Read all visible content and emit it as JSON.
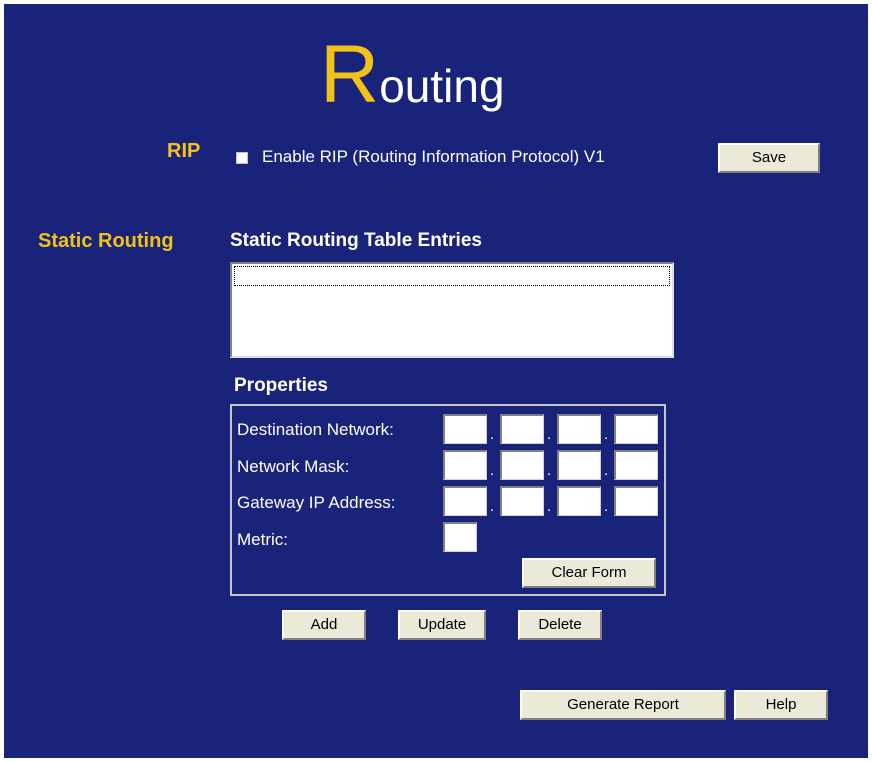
{
  "page": {
    "background": "#1a237a",
    "title_initial": "R",
    "title_rest": "outing",
    "accent_color": "#f2c21b"
  },
  "rip": {
    "section_label": "RIP",
    "checkbox_label": "Enable RIP (Routing Information Protocol) V1",
    "enabled": false,
    "save_label": "Save"
  },
  "static_routing": {
    "section_label": "Static Routing",
    "table_heading": "Static Routing Table Entries",
    "entries": []
  },
  "properties": {
    "heading": "Properties",
    "destination_label": "Destination Network:",
    "mask_label": "Network Mask:",
    "gateway_label": "Gateway IP Address:",
    "metric_label": "Metric:",
    "destination_octets": [
      "",
      "",
      "",
      ""
    ],
    "mask_octets": [
      "",
      "",
      "",
      ""
    ],
    "gateway_octets": [
      "",
      "",
      "",
      ""
    ],
    "metric_value": "",
    "octet_separator": ".",
    "clear_label": "Clear Form"
  },
  "actions": {
    "add_label": "Add",
    "update_label": "Update",
    "delete_label": "Delete",
    "report_label": "Generate Report",
    "help_label": "Help"
  }
}
